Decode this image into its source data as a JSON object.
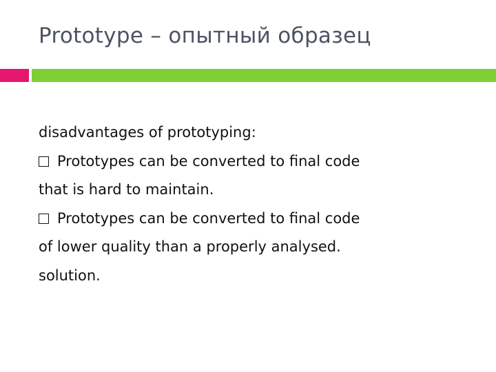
{
  "slide": {
    "title": "Prototype – опытный образец",
    "colors": {
      "title": "#4b5363",
      "accent_bar": "#e5176f",
      "main_bar": "#7ccf35",
      "text": "#111111"
    },
    "body": {
      "intro": "disadvantages of prototyping:",
      "bullets": [
        {
          "icon": "empty-square-bullet",
          "lines": [
            "Prototypes can be converted to final code",
            "that is hard to maintain."
          ]
        },
        {
          "icon": "empty-square-bullet",
          "lines": [
            "Prototypes can be converted to final code",
            "of lower quality than a properly analysed.",
            "solution."
          ]
        }
      ]
    }
  }
}
